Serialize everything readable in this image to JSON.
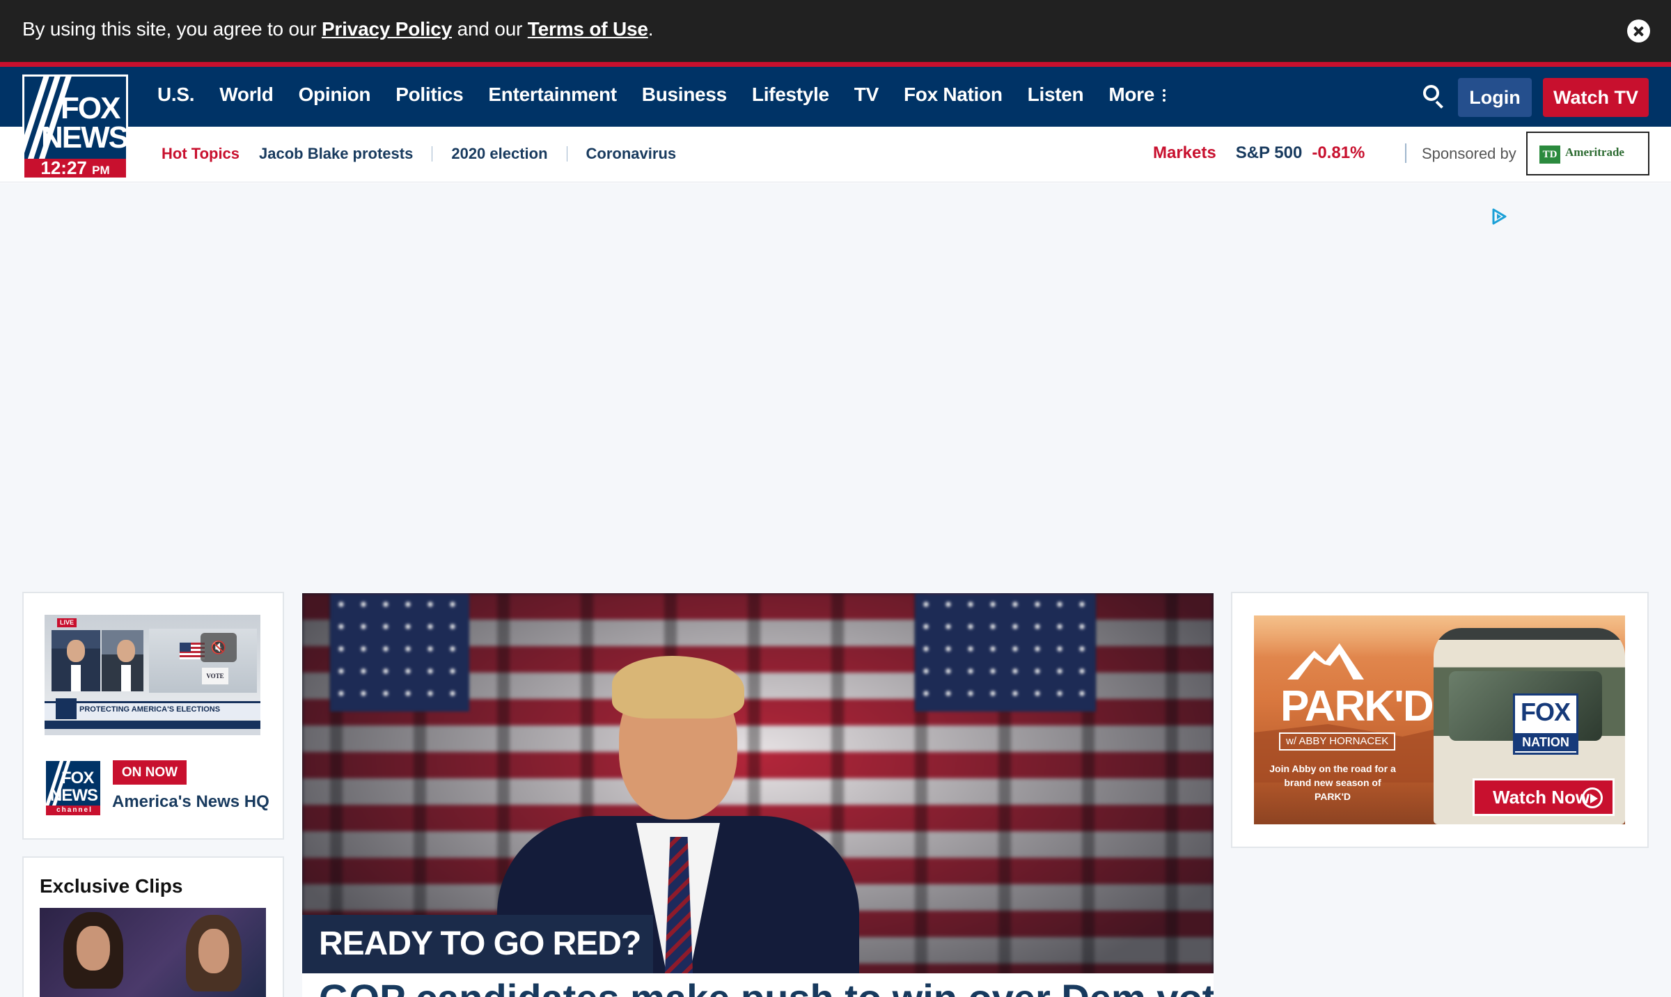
{
  "consent": {
    "prefix": "By using this site, you agree to our ",
    "privacy_link": "Privacy Policy",
    "middle": " and our ",
    "terms_link": "Terms of Use",
    "suffix": "."
  },
  "logo": {
    "line1": "FOX",
    "line2": "NEWS",
    "time": "12:27",
    "ampm": "PM"
  },
  "nav": {
    "items": [
      "U.S.",
      "World",
      "Opinion",
      "Politics",
      "Entertainment",
      "Business",
      "Lifestyle",
      "TV",
      "Fox Nation",
      "Listen",
      "More"
    ],
    "login": "Login",
    "watch_tv": "Watch TV"
  },
  "subnav": {
    "hot_label": "Hot Topics",
    "topics": [
      "Jacob Blake protests",
      "2020 election",
      "Coronavirus"
    ],
    "markets_label": "Markets",
    "index_name": "S&P 500",
    "index_change": "-0.81%",
    "sponsored_by": "Sponsored by",
    "sponsor_td": "TD",
    "sponsor_name": "Ameritrade"
  },
  "live": {
    "badge": "LIVE",
    "lower_third": "PROTECTING AMERICA'S ELECTIONS",
    "vote_sign": "VOTE",
    "logo_line1": "FOX",
    "logo_line2": "NEWS",
    "logo_channel": "channel",
    "on_now": "ON NOW",
    "show": "America's News HQ"
  },
  "clips": {
    "title": "Exclusive Clips"
  },
  "hero": {
    "tag": "READY TO GO RED?",
    "headline": "GOP candidates make push to win over Dem voters"
  },
  "promo": {
    "title": "PARK'D",
    "host": "w/ ABBY HORNACEK",
    "tagline": "Join Abby on the road for a brand new season of PARK'D",
    "brand_line1": "FOX",
    "brand_line2": "NATION",
    "cta": "Watch Now"
  },
  "colors": {
    "navy": "#003366",
    "red": "#c8102e",
    "consent_bg": "#212121"
  }
}
